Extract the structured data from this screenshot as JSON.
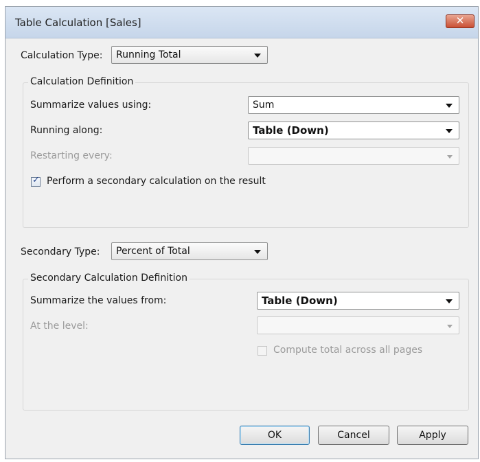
{
  "window": {
    "title": "Table Calculation [Sales]",
    "close_icon": "close-icon",
    "close_symbol": "✕"
  },
  "calculation_type": {
    "label": "Calculation Type:",
    "value": "Running Total"
  },
  "calculation_definition": {
    "title": "Calculation Definition",
    "summarize_label": "Summarize values using:",
    "summarize_value": "Sum",
    "running_along_label": "Running along:",
    "running_along_value": "Table (Down)",
    "restarting_label": "Restarting every:",
    "restarting_value": "",
    "secondary_checkbox_label": "Perform a secondary calculation on the result",
    "secondary_checkbox_checked": true
  },
  "secondary_type": {
    "label": "Secondary Type:",
    "value": "Percent of Total"
  },
  "secondary_definition": {
    "title": "Secondary Calculation Definition",
    "summarize_from_label": "Summarize the values from:",
    "summarize_from_value": "Table (Down)",
    "at_level_label": "At the level:",
    "at_level_value": "",
    "compute_total_label": "Compute total across all pages",
    "compute_total_checked": false
  },
  "buttons": {
    "ok": "OK",
    "cancel": "Cancel",
    "apply": "Apply"
  },
  "colors": {
    "titlebar": "#c6d6ea",
    "close_button": "#c94f34",
    "dialog_bg": "#f0f0f0",
    "default_button_border": "#3c7fb1"
  }
}
